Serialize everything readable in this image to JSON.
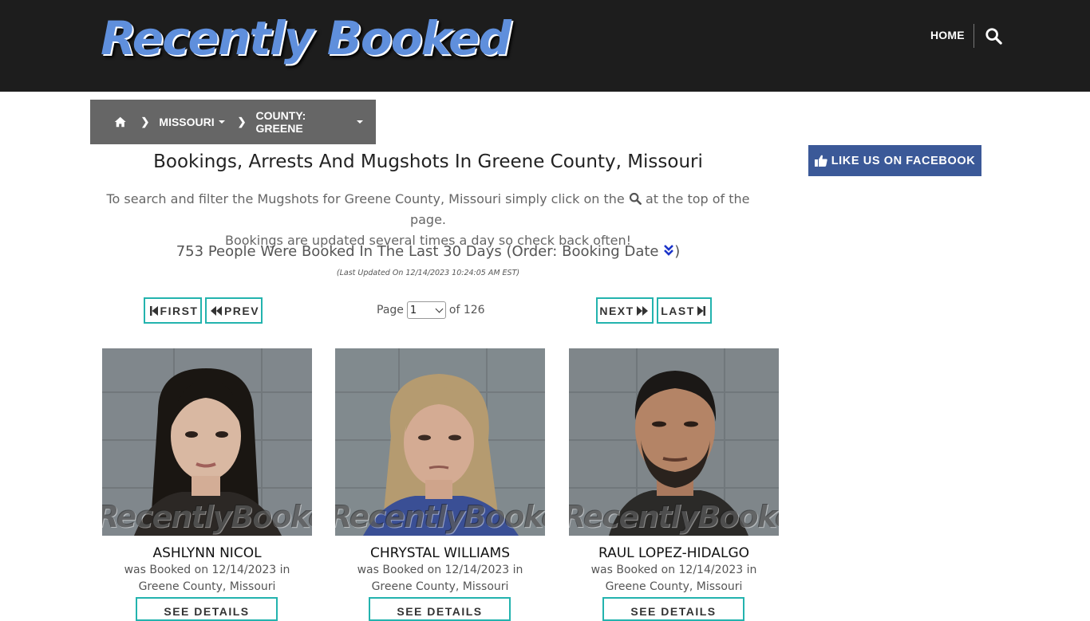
{
  "header": {
    "logo_text": "Recently Booked",
    "nav_home": "HOME",
    "search_icon": "search-icon"
  },
  "breadcrumb": {
    "home_icon": "home-icon",
    "items": [
      {
        "label": "MISSOURI"
      },
      {
        "label": "COUNTY: GREENE"
      }
    ]
  },
  "facebook": {
    "label": "LIKE US ON FACEBOOK",
    "color": "#3b5998"
  },
  "page": {
    "title": "Bookings, Arrests And Mugshots In Greene County, Missouri",
    "intro_part1": "To search and filter the Mugshots for Greene County, Missouri simply click on the",
    "intro_part2": "at the top of the page.",
    "intro_line2": "Bookings are updated several times a day so check back often!",
    "count_text": "753 People Were Booked In The Last 30 Days (Order: Booking Date",
    "count_close": ")",
    "last_updated": "(Last Updated On 12/14/2023 10:24:05 AM EST)"
  },
  "pagination": {
    "first": "FIRST",
    "prev": "PREV",
    "next": "NEXT",
    "last": "LAST",
    "page_label": "Page",
    "current_page": "1",
    "of_label": "of 126",
    "accent": "#23b3ae"
  },
  "bookings": [
    {
      "name": "ASHLYNN NICOL",
      "line1": "was Booked on 12/14/2023 in",
      "line2": "Greene County, Missouri",
      "button": "SEE DETAILS",
      "watermark": "RecentlyBooked.com"
    },
    {
      "name": "CHRYSTAL WILLIAMS",
      "line1": "was Booked on 12/14/2023 in",
      "line2": "Greene County, Missouri",
      "button": "SEE DETAILS",
      "watermark": "RecentlyBooked.com"
    },
    {
      "name": "RAUL LOPEZ-HIDALGO",
      "line1": "was Booked on 12/14/2023 in",
      "line2": "Greene County, Missouri",
      "button": "SEE DETAILS",
      "watermark": "RecentlyBooked.com"
    }
  ]
}
